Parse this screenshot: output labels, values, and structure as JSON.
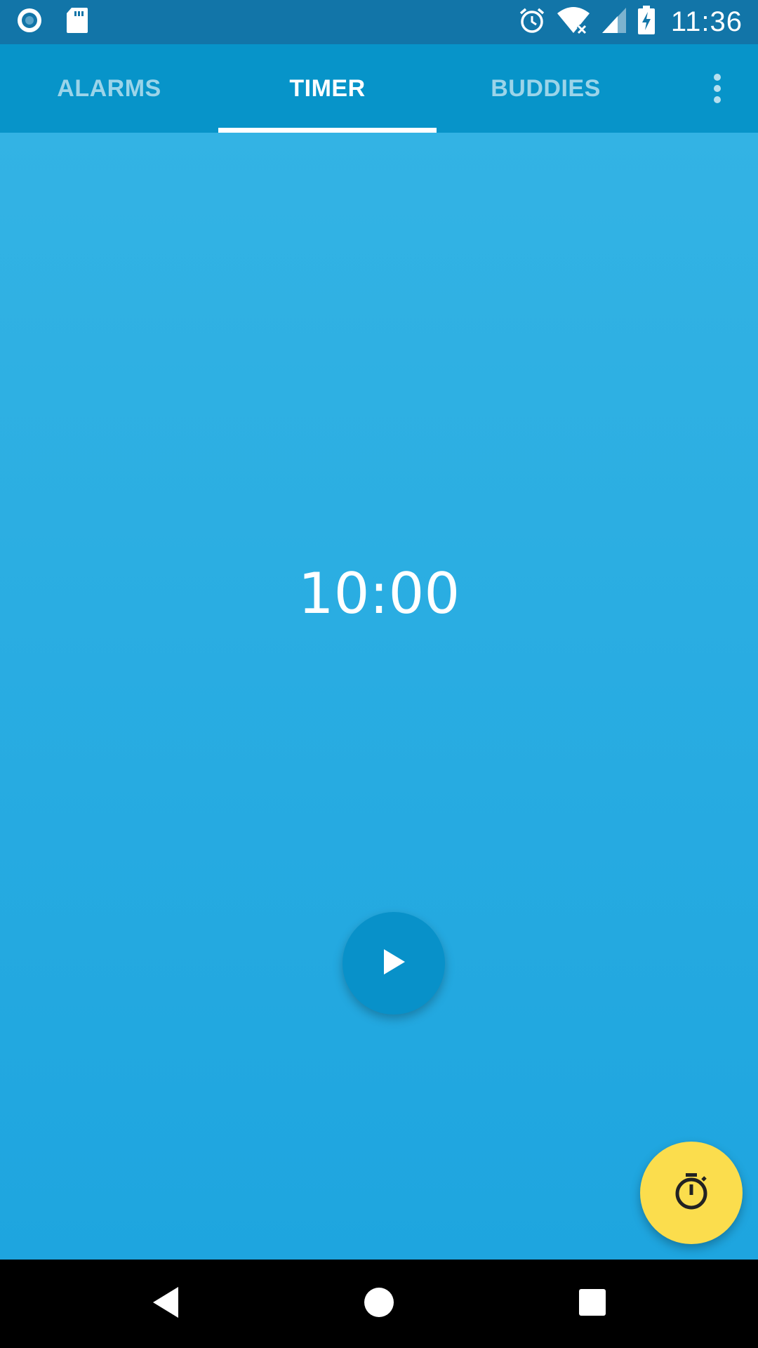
{
  "status_bar": {
    "time": "11:36",
    "icons": [
      "record-icon",
      "sd-card-icon",
      "alarm-icon",
      "wifi-off-icon",
      "signal-icon",
      "battery-charging-icon"
    ]
  },
  "tabs": [
    {
      "label": "ALARMS",
      "active": false
    },
    {
      "label": "TIMER",
      "active": true
    },
    {
      "label": "BUDDIES",
      "active": false
    }
  ],
  "timer": {
    "display": "10:00"
  },
  "icons": {
    "overflow": "more-vert-icon",
    "play": "play-icon",
    "fab": "stopwatch-icon",
    "nav_back": "back-icon",
    "nav_home": "home-icon",
    "nav_recents": "recents-icon"
  },
  "colors": {
    "status_bar": "#1275a8",
    "tab_bar": "#0794c9",
    "content_top": "#33b3e4",
    "content_bottom": "#1ea5df",
    "play_button": "#0891c9",
    "fab": "#fbdd4d"
  }
}
